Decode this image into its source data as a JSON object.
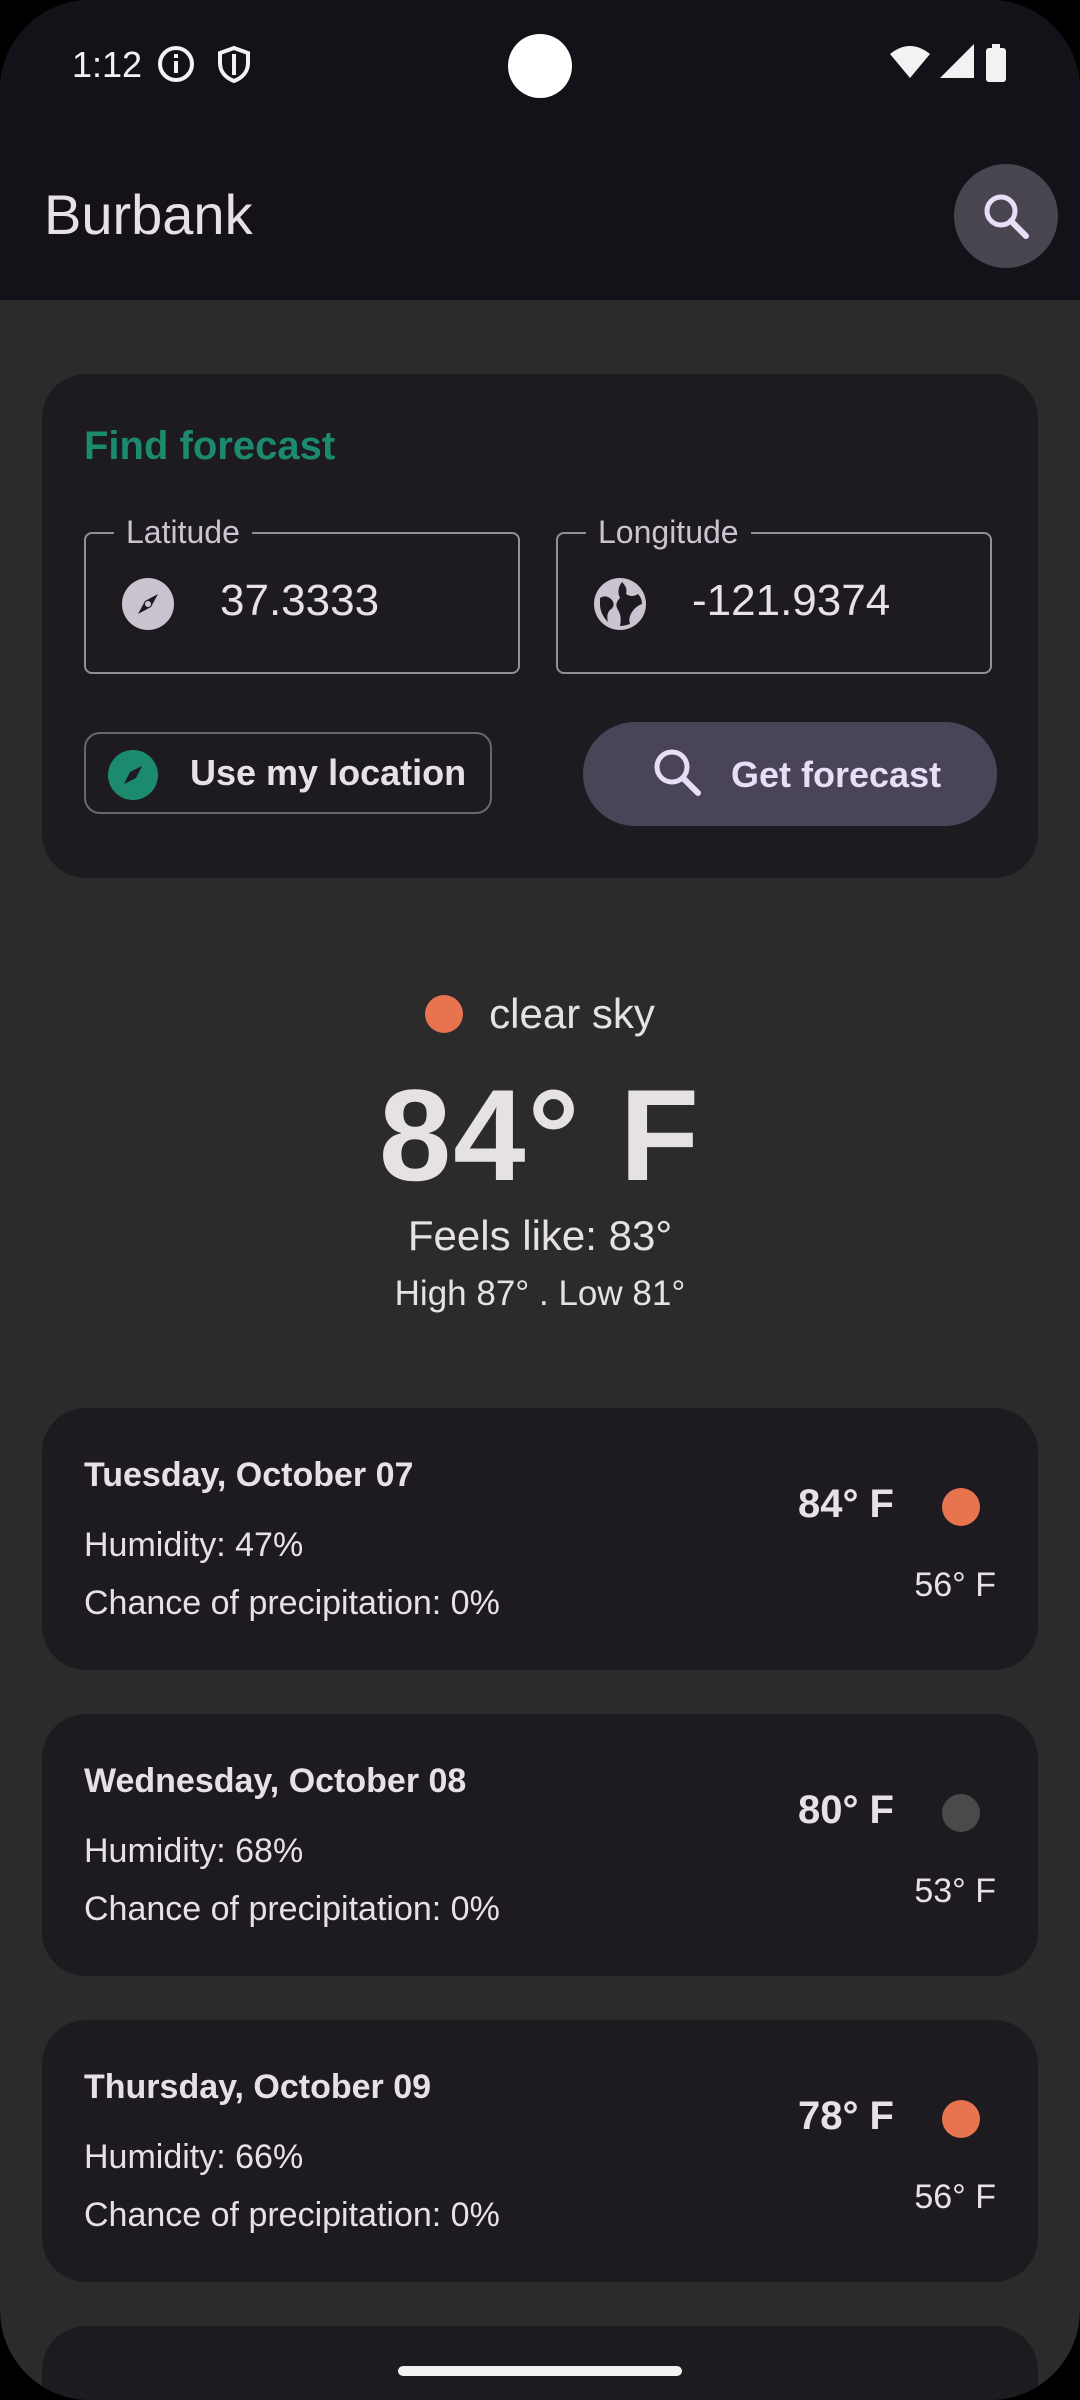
{
  "status_bar": {
    "time": "1:12"
  },
  "app_bar": {
    "title": "Burbank"
  },
  "find_forecast": {
    "title": "Find forecast",
    "latitude": {
      "label": "Latitude",
      "value": "37.3333"
    },
    "longitude": {
      "label": "Longitude",
      "value": "-121.9374"
    },
    "use_location_label": "Use my location",
    "get_forecast_label": "Get forecast"
  },
  "current": {
    "condition": "clear sky",
    "temperature": "84° F",
    "feels_like": "Feels like: 83°",
    "high_low": "High 87° . Low 81°"
  },
  "days": [
    {
      "name": "Tuesday, October 07",
      "humidity": "Humidity: 47%",
      "precipitation": "Chance of precipitation: 0%",
      "high": "84° F",
      "low": "56° F",
      "dot_color": "#e8734f"
    },
    {
      "name": "Wednesday, October 08",
      "humidity": "Humidity: 68%",
      "precipitation": "Chance of precipitation: 0%",
      "high": "80° F",
      "low": "53° F",
      "dot_color": "#4a4a4a"
    },
    {
      "name": "Thursday, October 09",
      "humidity": "Humidity: 66%",
      "precipitation": "Chance of precipitation: 0%",
      "high": "78° F",
      "low": "56° F",
      "dot_color": "#e8734f"
    }
  ],
  "colors": {
    "accent": "#1c8a6e",
    "sunny_dot": "#e8734f"
  }
}
